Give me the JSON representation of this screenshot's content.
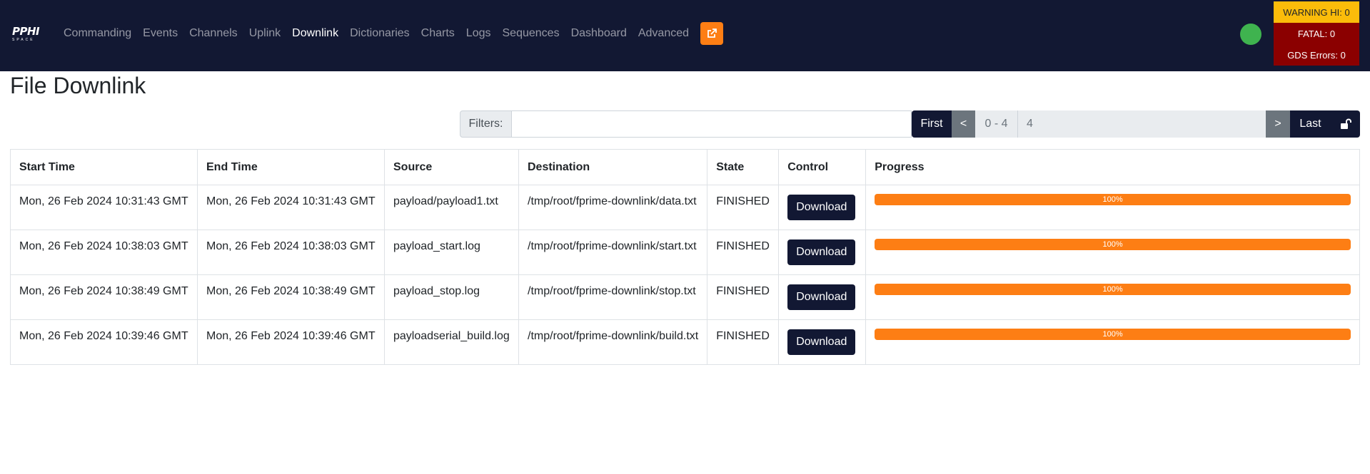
{
  "nav": {
    "brand_top": "PPHI",
    "brand_sub": "SPACE",
    "items": [
      {
        "label": "Commanding"
      },
      {
        "label": "Events"
      },
      {
        "label": "Channels"
      },
      {
        "label": "Uplink"
      },
      {
        "label": "Downlink",
        "active": true
      },
      {
        "label": "Dictionaries"
      },
      {
        "label": "Charts"
      },
      {
        "label": "Logs"
      },
      {
        "label": "Sequences"
      },
      {
        "label": "Dashboard"
      },
      {
        "label": "Advanced"
      }
    ],
    "external_icon": "external-link-icon",
    "status_color": "#3fb34f"
  },
  "errors": {
    "warning": "WARNING HI: 0",
    "fatal": "FATAL: 0",
    "gds": "GDS Errors: 0"
  },
  "page": {
    "title": "File Downlink"
  },
  "filter": {
    "label": "Filters:",
    "value": ""
  },
  "pagination": {
    "first": "First",
    "prev": "<",
    "range": "0 - 4",
    "count": "4",
    "next": ">",
    "last": "Last",
    "lock_icon": "unlock-icon"
  },
  "table": {
    "headers": {
      "start": "Start Time",
      "end": "End Time",
      "source": "Source",
      "destination": "Destination",
      "state": "State",
      "control": "Control",
      "progress": "Progress"
    },
    "rows": [
      {
        "start": "Mon, 26 Feb 2024 10:31:43 GMT",
        "end": "Mon, 26 Feb 2024 10:31:43 GMT",
        "source": "payload/payload1.txt",
        "destination": "/tmp/root/fprime-downlink/data.txt",
        "state": "FINISHED",
        "control": "Download",
        "progress_label": "100%",
        "progress": 100
      },
      {
        "start": "Mon, 26 Feb 2024 10:38:03 GMT",
        "end": "Mon, 26 Feb 2024 10:38:03 GMT",
        "source": "payload_start.log",
        "destination": "/tmp/root/fprime-downlink/start.txt",
        "state": "FINISHED",
        "control": "Download",
        "progress_label": "100%",
        "progress": 100
      },
      {
        "start": "Mon, 26 Feb 2024 10:38:49 GMT",
        "end": "Mon, 26 Feb 2024 10:38:49 GMT",
        "source": "payload_stop.log",
        "destination": "/tmp/root/fprime-downlink/stop.txt",
        "state": "FINISHED",
        "control": "Download",
        "progress_label": "100%",
        "progress": 100
      },
      {
        "start": "Mon, 26 Feb 2024 10:39:46 GMT",
        "end": "Mon, 26 Feb 2024 10:39:46 GMT",
        "source": "payloadserial_build.log",
        "destination": "/tmp/root/fprime-downlink/build.txt",
        "state": "FINISHED",
        "control": "Download",
        "progress_label": "100%",
        "progress": 100
      }
    ]
  },
  "colors": {
    "navbar": "#121833",
    "accent": "#fd7e14",
    "warning": "#fbbc0a",
    "fatal": "#8b0000"
  }
}
